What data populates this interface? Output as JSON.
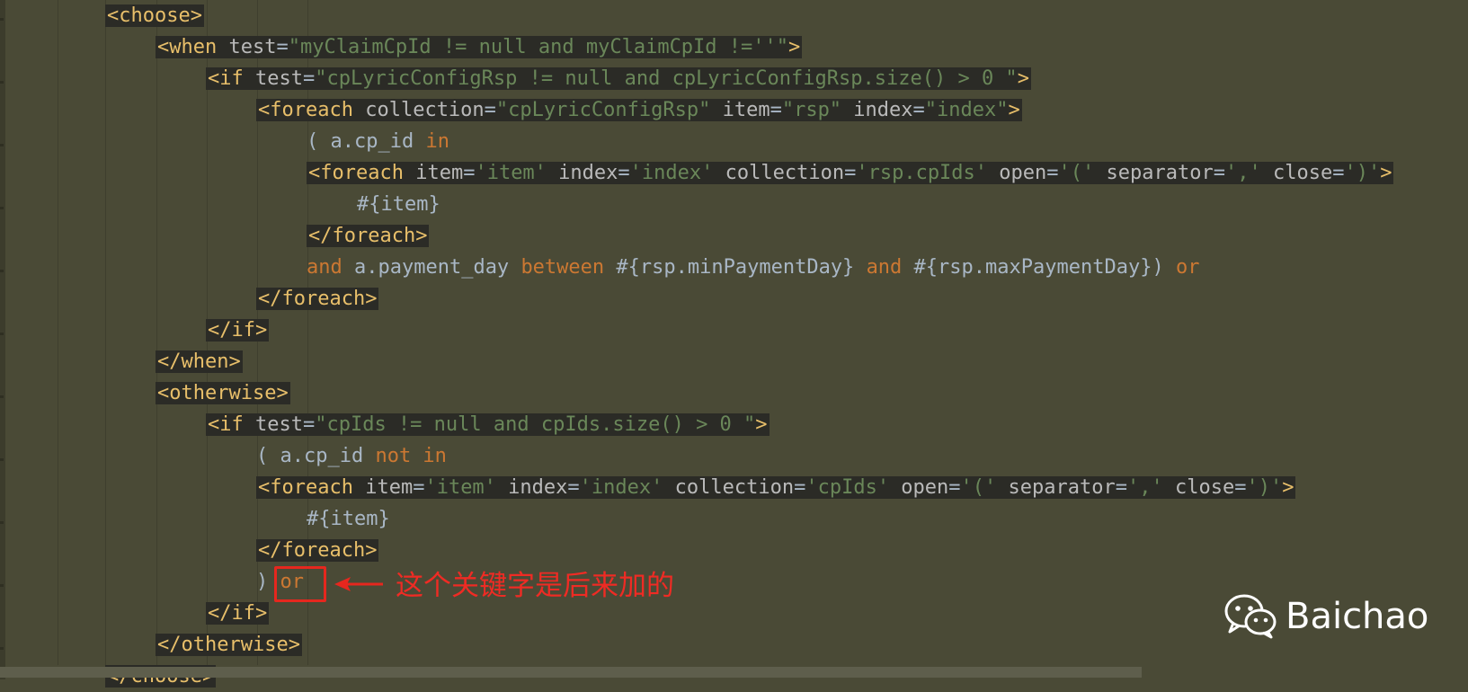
{
  "code": {
    "lines": [
      {
        "indent": 0,
        "highlight": true,
        "tokens": [
          {
            "t": "<choose>",
            "c": "tag"
          }
        ]
      },
      {
        "indent": 1,
        "highlight": true,
        "tokens": [
          {
            "t": "<when ",
            "c": "tag"
          },
          {
            "t": "test",
            "c": "attr"
          },
          {
            "t": "=",
            "c": "punc"
          },
          {
            "t": "\"myClaimCpId != null and myClaimCpId !=''\"",
            "c": "str"
          },
          {
            "t": ">",
            "c": "tag"
          }
        ]
      },
      {
        "indent": 2,
        "highlight": true,
        "tokens": [
          {
            "t": "<if ",
            "c": "tag"
          },
          {
            "t": "test",
            "c": "attr"
          },
          {
            "t": "=",
            "c": "punc"
          },
          {
            "t": "\"cpLyricConfigRsp != null and cpLyricConfigRsp.size() > 0 \"",
            "c": "str"
          },
          {
            "t": ">",
            "c": "tag"
          }
        ]
      },
      {
        "indent": 3,
        "highlight": true,
        "tokens": [
          {
            "t": "<foreach ",
            "c": "tag"
          },
          {
            "t": "collection",
            "c": "attr"
          },
          {
            "t": "=",
            "c": "punc"
          },
          {
            "t": "\"cpLyricConfigRsp\"",
            "c": "str"
          },
          {
            "t": " item",
            "c": "attr"
          },
          {
            "t": "=",
            "c": "punc"
          },
          {
            "t": "\"rsp\"",
            "c": "str"
          },
          {
            "t": " index",
            "c": "attr"
          },
          {
            "t": "=",
            "c": "punc"
          },
          {
            "t": "\"index\"",
            "c": "str"
          },
          {
            "t": ">",
            "c": "tag"
          }
        ]
      },
      {
        "indent": 4,
        "highlight": false,
        "tokens": [
          {
            "t": "( a.cp_id ",
            "c": "txt"
          },
          {
            "t": "in",
            "c": "kw"
          }
        ]
      },
      {
        "indent": 4,
        "highlight": true,
        "tokens": [
          {
            "t": "<foreach ",
            "c": "tag"
          },
          {
            "t": "item",
            "c": "attr"
          },
          {
            "t": "=",
            "c": "punc"
          },
          {
            "t": "'item'",
            "c": "str"
          },
          {
            "t": " index",
            "c": "attr"
          },
          {
            "t": "=",
            "c": "punc"
          },
          {
            "t": "'index'",
            "c": "str"
          },
          {
            "t": " collection",
            "c": "attr"
          },
          {
            "t": "=",
            "c": "punc"
          },
          {
            "t": "'rsp.cpIds'",
            "c": "str"
          },
          {
            "t": " open",
            "c": "attr"
          },
          {
            "t": "=",
            "c": "punc"
          },
          {
            "t": "'('",
            "c": "str"
          },
          {
            "t": " separator",
            "c": "attr"
          },
          {
            "t": "=",
            "c": "punc"
          },
          {
            "t": "','",
            "c": "str"
          },
          {
            "t": " close",
            "c": "attr"
          },
          {
            "t": "=",
            "c": "punc"
          },
          {
            "t": "')'",
            "c": "str"
          },
          {
            "t": ">",
            "c": "tag"
          }
        ]
      },
      {
        "indent": 5,
        "highlight": false,
        "tokens": [
          {
            "t": "#{item}",
            "c": "txt"
          }
        ]
      },
      {
        "indent": 4,
        "highlight": true,
        "tokens": [
          {
            "t": "</foreach>",
            "c": "tag"
          }
        ]
      },
      {
        "indent": 4,
        "highlight": false,
        "tokens": [
          {
            "t": "and",
            "c": "kw"
          },
          {
            "t": " a.payment_day ",
            "c": "txt"
          },
          {
            "t": "between",
            "c": "kw"
          },
          {
            "t": " #{rsp.minPaymentDay} ",
            "c": "txt"
          },
          {
            "t": "and",
            "c": "kw"
          },
          {
            "t": " #{rsp.maxPaymentDay}) ",
            "c": "txt"
          },
          {
            "t": "or",
            "c": "kw"
          }
        ]
      },
      {
        "indent": 3,
        "highlight": true,
        "tokens": [
          {
            "t": "</foreach>",
            "c": "tag"
          }
        ]
      },
      {
        "indent": 2,
        "highlight": true,
        "tokens": [
          {
            "t": "</if>",
            "c": "tag"
          }
        ]
      },
      {
        "indent": 1,
        "highlight": true,
        "tokens": [
          {
            "t": "</when>",
            "c": "tag"
          }
        ]
      },
      {
        "indent": 1,
        "highlight": true,
        "tokens": [
          {
            "t": "<otherwise>",
            "c": "tag"
          }
        ]
      },
      {
        "indent": 2,
        "highlight": true,
        "tokens": [
          {
            "t": "<if ",
            "c": "tag"
          },
          {
            "t": "test",
            "c": "attr"
          },
          {
            "t": "=",
            "c": "punc"
          },
          {
            "t": "\"cpIds != null and cpIds.size() > 0 \"",
            "c": "str"
          },
          {
            "t": ">",
            "c": "tag"
          }
        ]
      },
      {
        "indent": 3,
        "highlight": false,
        "tokens": [
          {
            "t": "( a.cp_id ",
            "c": "txt"
          },
          {
            "t": "not in",
            "c": "kw"
          }
        ]
      },
      {
        "indent": 3,
        "highlight": true,
        "tokens": [
          {
            "t": "<foreach ",
            "c": "tag"
          },
          {
            "t": "item",
            "c": "attr"
          },
          {
            "t": "=",
            "c": "punc"
          },
          {
            "t": "'item'",
            "c": "str"
          },
          {
            "t": " index",
            "c": "attr"
          },
          {
            "t": "=",
            "c": "punc"
          },
          {
            "t": "'index'",
            "c": "str"
          },
          {
            "t": " collection",
            "c": "attr"
          },
          {
            "t": "=",
            "c": "punc"
          },
          {
            "t": "'cpIds'",
            "c": "str"
          },
          {
            "t": " open",
            "c": "attr"
          },
          {
            "t": "=",
            "c": "punc"
          },
          {
            "t": "'('",
            "c": "str"
          },
          {
            "t": " separator",
            "c": "attr"
          },
          {
            "t": "=",
            "c": "punc"
          },
          {
            "t": "','",
            "c": "str"
          },
          {
            "t": " close",
            "c": "attr"
          },
          {
            "t": "=",
            "c": "punc"
          },
          {
            "t": "')'",
            "c": "str"
          },
          {
            "t": ">",
            "c": "tag"
          }
        ]
      },
      {
        "indent": 4,
        "highlight": false,
        "tokens": [
          {
            "t": "#{item}",
            "c": "txt"
          }
        ]
      },
      {
        "indent": 3,
        "highlight": true,
        "tokens": [
          {
            "t": "</foreach>",
            "c": "tag"
          }
        ]
      },
      {
        "indent": 3,
        "highlight": false,
        "tokens": [
          {
            "t": ") ",
            "c": "txt"
          },
          {
            "t": "or",
            "c": "kw"
          }
        ]
      },
      {
        "indent": 2,
        "highlight": true,
        "tokens": [
          {
            "t": "</if>",
            "c": "tag"
          }
        ]
      },
      {
        "indent": 1,
        "highlight": true,
        "tokens": [
          {
            "t": "</otherwise>",
            "c": "tag"
          }
        ]
      },
      {
        "indent": 0,
        "highlight": true,
        "tokens": [
          {
            "t": "</choose>",
            "c": "tag"
          }
        ]
      }
    ]
  },
  "annotation": {
    "text": "这个关键字是后来加的",
    "color": "#e6271e"
  },
  "watermark": {
    "icon": "wechat-icon",
    "text": "Baichao"
  },
  "colors": {
    "background": "#4a4a36",
    "tag": "#e8bf6a",
    "string": "#6a8759",
    "keyword": "#cc7832",
    "attribute": "#bababa",
    "text": "#a9b7c6",
    "highlight_bg": "#2b2b26"
  }
}
